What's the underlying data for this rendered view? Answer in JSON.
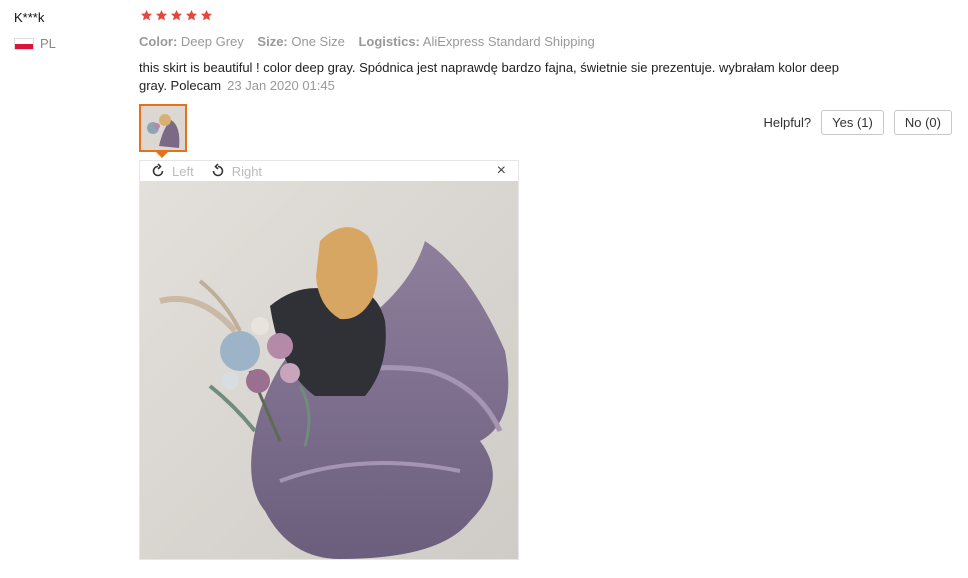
{
  "user": {
    "name": "K***k",
    "country": "PL"
  },
  "rating": {
    "stars": 5,
    "star_color": "#e4473e"
  },
  "attributes": [
    {
      "key": "Color:",
      "value": "Deep Grey"
    },
    {
      "key": "Size:",
      "value": "One Size"
    },
    {
      "key": "Logistics:",
      "value": "AliExpress Standard Shipping"
    }
  ],
  "review": {
    "text": "this skirt is beautiful ! color deep gray. Spódnica jest naprawdę bardzo fajna, świetnie sie prezentuje. wybrałam kolor deep gray. Polecam",
    "date": "23 Jan 2020 01:45"
  },
  "helpful": {
    "label": "Helpful?",
    "yes_label": "Yes (1)",
    "no_label": "No (0)"
  },
  "viewer": {
    "rotate_left_label": "Left",
    "rotate_right_label": "Right",
    "close_glyph": "×"
  },
  "colors": {
    "accent": "#e4721c",
    "muted": "#999999",
    "flag_red": "#dc143c"
  }
}
